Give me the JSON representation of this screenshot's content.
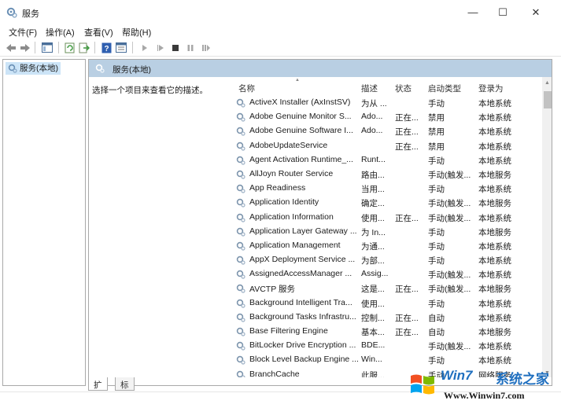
{
  "window": {
    "title": "服务",
    "minimize_glyph": "—",
    "maximize_glyph": "☐",
    "close_glyph": "✕"
  },
  "menu": [
    "文件(F)",
    "操作(A)",
    "查看(V)",
    "帮助(H)"
  ],
  "toolbar_icons": [
    "back-icon",
    "forward-icon",
    "console-tree-icon",
    "refresh-icon",
    "export-list-icon",
    "help-icon",
    "properties-icon",
    "start-icon",
    "start-alt-icon",
    "stop-icon",
    "pause-icon",
    "restart-icon"
  ],
  "tree": {
    "root_label": "服务(本地)"
  },
  "content": {
    "header_title": "服务(本地)",
    "description_prompt": "选择一个项目来查看它的描述。"
  },
  "columns": {
    "name": "名称",
    "description": "描述",
    "status": "状态",
    "startup_type": "启动类型",
    "logon_as": "登录为"
  },
  "services": [
    {
      "name": "ActiveX Installer (AxInstSV)",
      "description": "为从 ...",
      "status": "",
      "startup": "手动",
      "logon": "本地系统"
    },
    {
      "name": "Adobe Genuine Monitor S...",
      "description": "Ado...",
      "status": "正在...",
      "startup": "禁用",
      "logon": "本地系统"
    },
    {
      "name": "Adobe Genuine Software I...",
      "description": "Ado...",
      "status": "正在...",
      "startup": "禁用",
      "logon": "本地系统"
    },
    {
      "name": "AdobeUpdateService",
      "description": "",
      "status": "正在...",
      "startup": "禁用",
      "logon": "本地系统"
    },
    {
      "name": "Agent Activation Runtime_...",
      "description": "Runt...",
      "status": "",
      "startup": "手动",
      "logon": "本地系统"
    },
    {
      "name": "AllJoyn Router Service",
      "description": "路由...",
      "status": "",
      "startup": "手动(触发...",
      "logon": "本地服务"
    },
    {
      "name": "App Readiness",
      "description": "当用...",
      "status": "",
      "startup": "手动",
      "logon": "本地系统"
    },
    {
      "name": "Application Identity",
      "description": "确定...",
      "status": "",
      "startup": "手动(触发...",
      "logon": "本地服务"
    },
    {
      "name": "Application Information",
      "description": "使用...",
      "status": "正在...",
      "startup": "手动(触发...",
      "logon": "本地系统"
    },
    {
      "name": "Application Layer Gateway ...",
      "description": "为 In...",
      "status": "",
      "startup": "手动",
      "logon": "本地服务"
    },
    {
      "name": "Application Management",
      "description": "为通...",
      "status": "",
      "startup": "手动",
      "logon": "本地系统"
    },
    {
      "name": "AppX Deployment Service ...",
      "description": "为部...",
      "status": "",
      "startup": "手动",
      "logon": "本地系统"
    },
    {
      "name": "AssignedAccessManager ...",
      "description": "Assig...",
      "status": "",
      "startup": "手动(触发...",
      "logon": "本地系统"
    },
    {
      "name": "AVCTP 服务",
      "description": "这是...",
      "status": "正在...",
      "startup": "手动(触发...",
      "logon": "本地服务"
    },
    {
      "name": "Background Intelligent Tra...",
      "description": "使用...",
      "status": "",
      "startup": "手动",
      "logon": "本地系统"
    },
    {
      "name": "Background Tasks Infrastru...",
      "description": "控制...",
      "status": "正在...",
      "startup": "自动",
      "logon": "本地系统"
    },
    {
      "name": "Base Filtering Engine",
      "description": "基本...",
      "status": "正在...",
      "startup": "自动",
      "logon": "本地服务"
    },
    {
      "name": "BitLocker Drive Encryption ...",
      "description": "BDE...",
      "status": "",
      "startup": "手动(触发...",
      "logon": "本地系统"
    },
    {
      "name": "Block Level Backup Engine ...",
      "description": "Win...",
      "status": "",
      "startup": "手动",
      "logon": "本地系统"
    },
    {
      "name": "BranchCache",
      "description": "此服...",
      "status": "",
      "startup": "手动",
      "logon": "网络服务"
    }
  ],
  "tabs": [
    "扩展",
    "标准"
  ],
  "watermark": {
    "brand": "Win7",
    "brand_cn": "系统之家",
    "url": "Www.Winwin7.com"
  },
  "colors": {
    "content_header_bg": "#b9cfe3",
    "tree_selected_bg": "#cce4f7",
    "watermark_blue": "#1f6fbf"
  }
}
